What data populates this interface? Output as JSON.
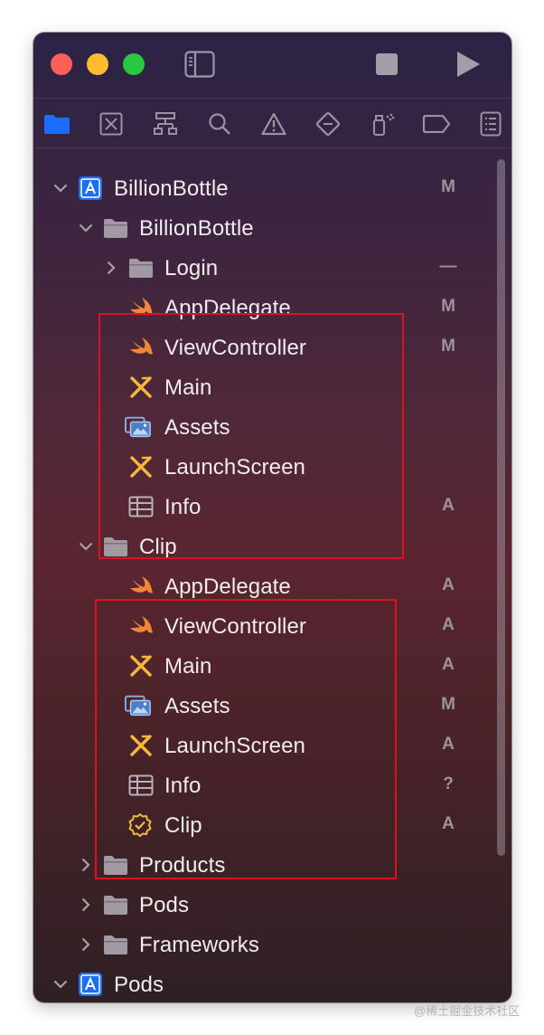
{
  "navigator": {
    "rows": [
      {
        "label": "BillionBottle",
        "status": "M"
      },
      {
        "label": "BillionBottle",
        "status": ""
      },
      {
        "label": "Login",
        "status": "—"
      },
      {
        "label": "AppDelegate",
        "status": "M"
      },
      {
        "label": "ViewController",
        "status": "M"
      },
      {
        "label": "Main",
        "status": ""
      },
      {
        "label": "Assets",
        "status": ""
      },
      {
        "label": "LaunchScreen",
        "status": ""
      },
      {
        "label": "Info",
        "status": "A"
      },
      {
        "label": "Clip",
        "status": ""
      },
      {
        "label": "AppDelegate",
        "status": "A"
      },
      {
        "label": "ViewController",
        "status": "A"
      },
      {
        "label": "Main",
        "status": "A"
      },
      {
        "label": "Assets",
        "status": "M"
      },
      {
        "label": "LaunchScreen",
        "status": "A"
      },
      {
        "label": "Info",
        "status": "?"
      },
      {
        "label": "Clip",
        "status": "A"
      },
      {
        "label": "Products",
        "status": ""
      },
      {
        "label": "Pods",
        "status": ""
      },
      {
        "label": "Frameworks",
        "status": ""
      },
      {
        "label": "Pods",
        "status": ""
      }
    ]
  },
  "icons": {
    "toolbar": [
      "sidebar-toggle-icon",
      "stop-icon",
      "run-icon"
    ],
    "navigator_tabs": [
      "folder-icon",
      "source-control-icon",
      "hierarchy-icon",
      "search-icon",
      "warning-icon",
      "test-diamond-icon",
      "debug-spray-icon",
      "breakpoint-icon",
      "report-icon"
    ]
  },
  "colors": {
    "accent": "#1a6dff",
    "swift": "#f0863a",
    "storyboard": "#f5b83c",
    "highlight_box": "#d8141f"
  },
  "watermark": "@稀土掘金技术社区"
}
